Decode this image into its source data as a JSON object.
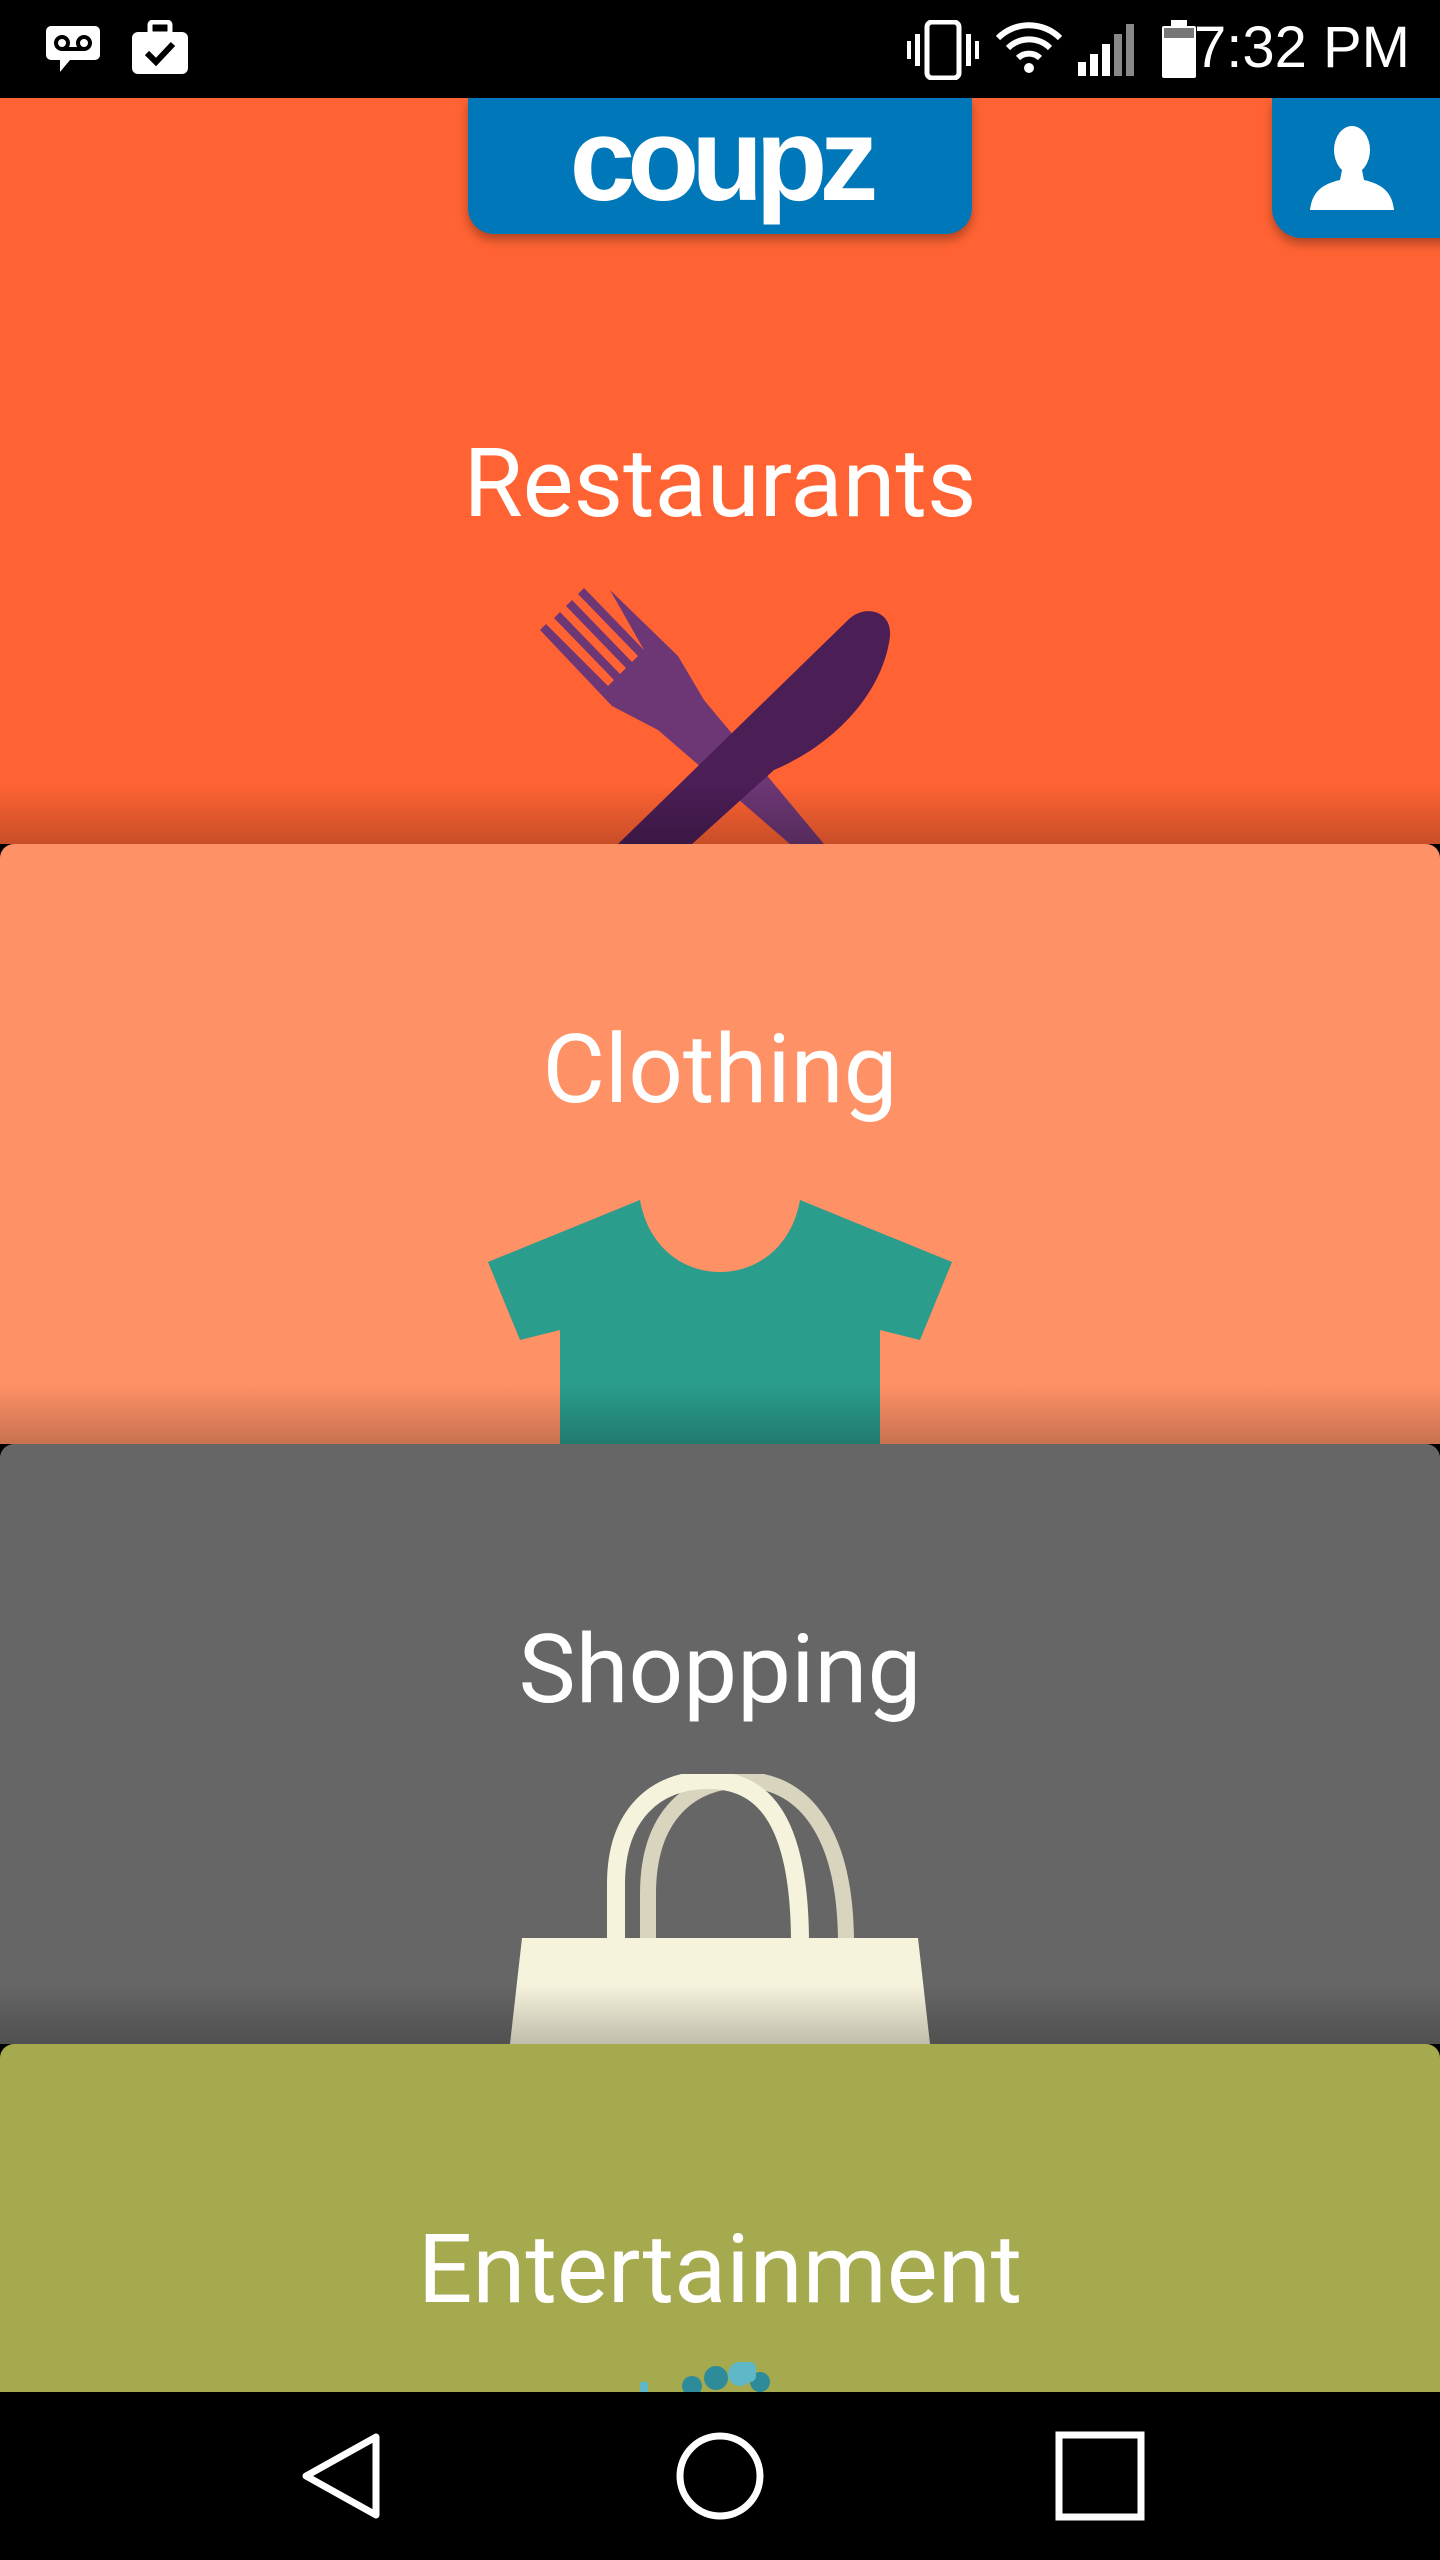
{
  "status_bar": {
    "time": "7:32 PM",
    "left_icons": [
      "voicemail-icon",
      "briefcase-check-icon"
    ],
    "right_icons": [
      "vibrate-icon",
      "wifi-icon",
      "cell-signal-icon",
      "battery-icon"
    ]
  },
  "header": {
    "logo_text": "coupz",
    "profile_icon": "person-icon",
    "accent_color": "#0077b8"
  },
  "categories": [
    {
      "label": "Restaurants",
      "icon": "fork-knife-icon",
      "color": "#ff6333"
    },
    {
      "label": "Clothing",
      "icon": "tshirt-icon",
      "color": "#ff9166"
    },
    {
      "label": "Shopping",
      "icon": "shopping-bag-icon",
      "color": "#666666"
    },
    {
      "label": "Entertainment",
      "icon": "entertainment-icon",
      "color": "#a6aa4f"
    }
  ],
  "nav_bar": {
    "buttons": [
      "back-icon",
      "home-icon",
      "recents-icon"
    ]
  }
}
